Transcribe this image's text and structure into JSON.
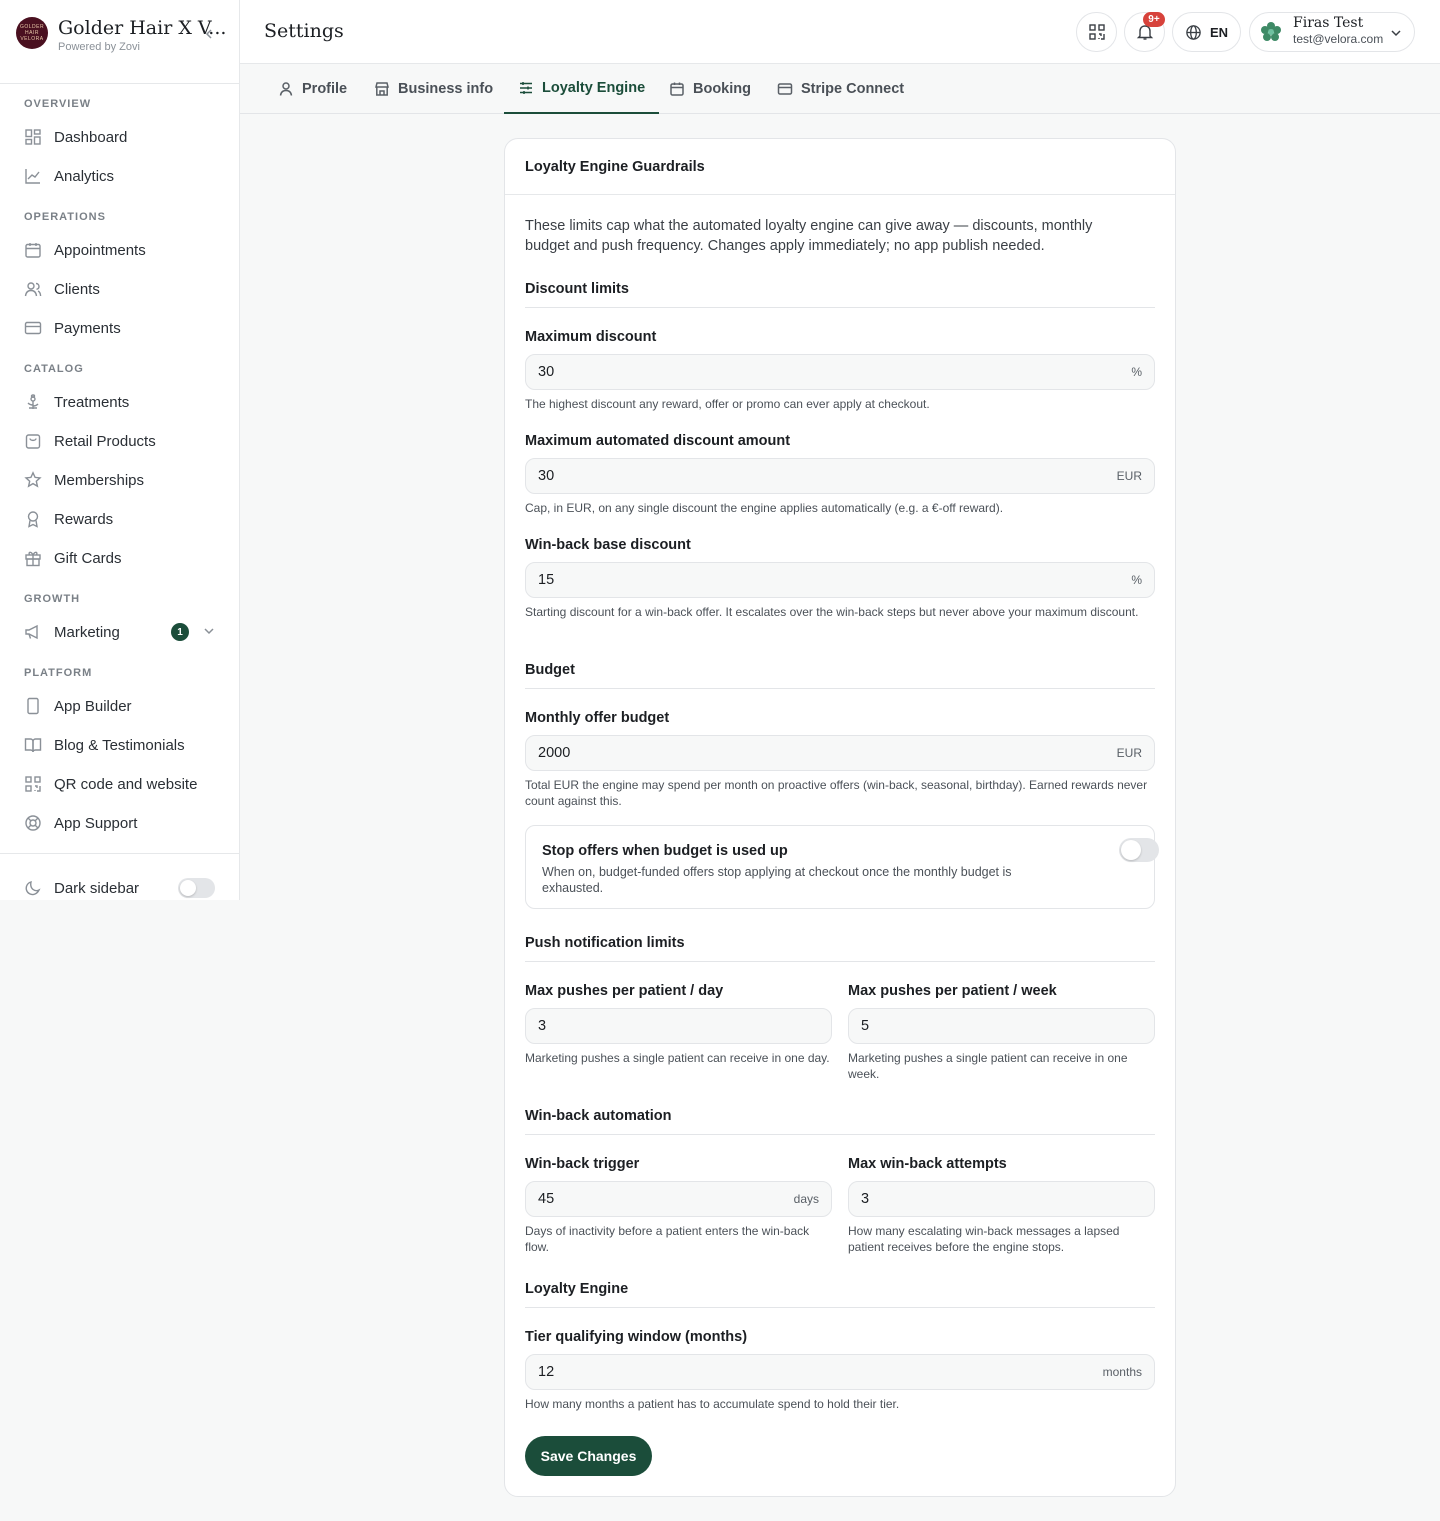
{
  "brand": {
    "name": "Golder Hair X V...",
    "subtitle": "Powered by Zovi",
    "logo_top": "GOLDER HAIR",
    "logo_bottom": "VELORA"
  },
  "sidebar": {
    "sections": {
      "overview": "OVERVIEW",
      "operations": "OPERATIONS",
      "catalog": "CATALOG",
      "growth": "GROWTH",
      "platform": "PLATFORM"
    },
    "items": {
      "dashboard": "Dashboard",
      "analytics": "Analytics",
      "appointments": "Appointments",
      "clients": "Clients",
      "payments": "Payments",
      "treatments": "Treatments",
      "retail": "Retail Products",
      "memberships": "Memberships",
      "rewards": "Rewards",
      "giftcards": "Gift Cards",
      "marketing": "Marketing",
      "appbuilder": "App Builder",
      "blog": "Blog & Testimonials",
      "qr": "QR code and website",
      "support": "App Support"
    },
    "marketing_badge": "1",
    "dark_sidebar_label": "Dark sidebar",
    "dark_sidebar_on": false
  },
  "header": {
    "title": "Settings",
    "notification_count": "9+",
    "language": "EN",
    "user_name": "Firas Test",
    "user_email": "test@velora.com"
  },
  "tabs": {
    "profile": "Profile",
    "business": "Business info",
    "loyalty": "Loyalty Engine",
    "booking": "Booking",
    "stripe": "Stripe Connect",
    "active": "Loyalty Engine"
  },
  "card": {
    "title": "Loyalty Engine Guardrails",
    "intro": "These limits cap what the automated loyalty engine can give away — discounts, monthly budget and push frequency. Changes apply immediately; no app publish needed.",
    "discount": {
      "heading": "Discount limits",
      "max_discount": {
        "label": "Maximum discount",
        "value": "30",
        "suffix": "%",
        "help": "The highest discount any reward, offer or promo can ever apply at checkout."
      },
      "max_auto": {
        "label": "Maximum automated discount amount",
        "value": "30",
        "suffix": "EUR",
        "help": "Cap, in EUR, on any single discount the engine applies automatically (e.g. a €-off reward)."
      },
      "winback_base": {
        "label": "Win-back base discount",
        "value": "15",
        "suffix": "%",
        "help": "Starting discount for a win-back offer. It escalates over the win-back steps but never above your maximum discount."
      }
    },
    "budget": {
      "heading": "Budget",
      "monthly": {
        "label": "Monthly offer budget",
        "value": "2000",
        "suffix": "EUR",
        "help": "Total EUR the engine may spend per month on proactive offers (win-back, seasonal, birthday). Earned rewards never count against this."
      },
      "stop": {
        "label": "Stop offers when budget is used up",
        "help": "When on, budget-funded offers stop applying at checkout once the monthly budget is exhausted.",
        "on": false
      }
    },
    "push": {
      "heading": "Push notification limits",
      "day": {
        "label": "Max pushes per patient / day",
        "value": "3",
        "help": "Marketing pushes a single patient can receive in one day."
      },
      "week": {
        "label": "Max pushes per patient / week",
        "value": "5",
        "help": "Marketing pushes a single patient can receive in one week."
      }
    },
    "winback": {
      "heading": "Win-back automation",
      "trigger": {
        "label": "Win-back trigger",
        "value": "45",
        "suffix": "days",
        "help": "Days of inactivity before a patient enters the win-back flow."
      },
      "attempts": {
        "label": "Max win-back attempts",
        "value": "3",
        "help": "How many escalating win-back messages a lapsed patient receives before the engine stops."
      }
    },
    "loyalty": {
      "heading": "Loyalty Engine",
      "tier": {
        "label": "Tier qualifying window (months)",
        "value": "12",
        "suffix": "months",
        "help": "How many months a patient has to accumulate spend to hold their tier."
      }
    },
    "save_label": "Save Changes"
  },
  "colors": {
    "accent": "#1b4d3a",
    "badge": "#d7423b",
    "brand_logo": "#4a1020"
  }
}
